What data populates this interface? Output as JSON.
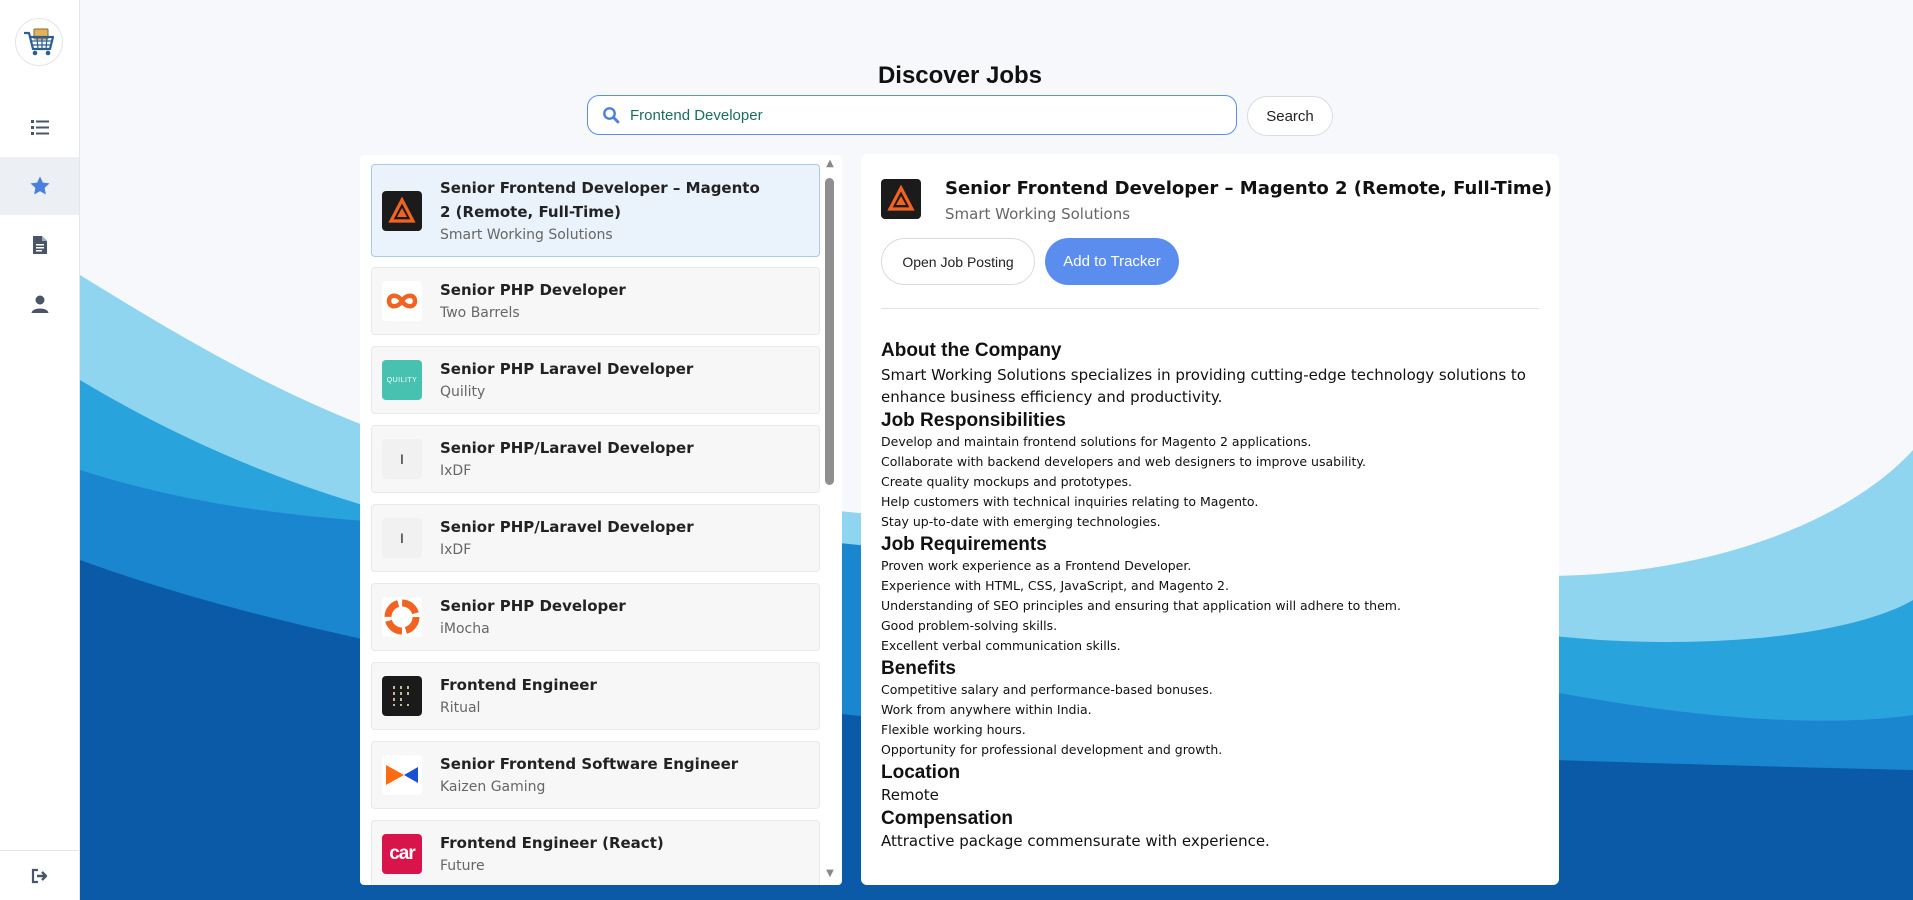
{
  "colors": {
    "accent": "#5b8def",
    "sidebar_active_bg": "#eceff4",
    "wave_light": "#8fd5f0",
    "wave_mid": "#29a3dc",
    "wave_dark": "#0e6fbd",
    "wave_deep": "#0b5aa8"
  },
  "sidebar": {
    "logo_icon": "shopping-cart-icon",
    "items": [
      {
        "name": "list-icon",
        "active": false
      },
      {
        "name": "star-icon",
        "active": true
      },
      {
        "name": "document-icon",
        "active": false
      },
      {
        "name": "user-icon",
        "active": false
      }
    ],
    "logout_icon": "logout-icon"
  },
  "header": {
    "title": "Discover Jobs"
  },
  "search": {
    "value": "Frontend Developer",
    "button_label": "Search"
  },
  "jobs": [
    {
      "title": "Senior Frontend Developer – Magento 2 (Remote, Full-Time)",
      "company": "Smart Working Solutions",
      "logo": "magento-a-logo"
    },
    {
      "title": "Senior PHP Developer",
      "company": "Two Barrels",
      "logo": "infinity-logo"
    },
    {
      "title": "Senior PHP Laravel Developer",
      "company": "Quility",
      "logo": "quility-logo",
      "logo_text": "QUILITY"
    },
    {
      "title": "Senior PHP/Laravel Developer",
      "company": "IxDF",
      "logo": "ixdf-logo",
      "logo_text": "I"
    },
    {
      "title": "Senior PHP/Laravel Developer",
      "company": "IxDF",
      "logo": "ixdf-logo",
      "logo_text": "I"
    },
    {
      "title": "Senior PHP Developer",
      "company": "iMocha",
      "logo": "imocha-logo"
    },
    {
      "title": "Frontend Engineer",
      "company": "Ritual",
      "logo": "ritual-logo"
    },
    {
      "title": "Senior Frontend Software Engineer",
      "company": "Kaizen Gaming",
      "logo": "kaizen-logo"
    },
    {
      "title": "Frontend Engineer (React)",
      "company": "Future",
      "logo": "future-logo",
      "logo_text": "car"
    }
  ],
  "detail": {
    "title": "Senior Frontend Developer – Magento 2 (Remote, Full-Time)",
    "company": "Smart Working Solutions",
    "open_button": "Open Job Posting",
    "track_button": "Add to Tracker",
    "about_heading": "About the Company",
    "about_text": "Smart Working Solutions specializes in providing cutting-edge technology solutions to enhance business efficiency and productivity.",
    "resp_heading": "Job Responsibilities",
    "responsibilities": [
      "Develop and maintain frontend solutions for Magento 2 applications.",
      "Collaborate with backend developers and web designers to improve usability.",
      "Create quality mockups and prototypes.",
      "Help customers with technical inquiries relating to Magento.",
      "Stay up-to-date with emerging technologies."
    ],
    "req_heading": "Job Requirements",
    "requirements": [
      "Proven work experience as a Frontend Developer.",
      "Experience with HTML, CSS, JavaScript, and Magento 2.",
      "Understanding of SEO principles and ensuring that application will adhere to them.",
      "Good problem-solving skills.",
      "Excellent verbal communication skills."
    ],
    "benefits_heading": "Benefits",
    "benefits": [
      "Competitive salary and performance-based bonuses.",
      "Work from anywhere within India.",
      "Flexible working hours.",
      "Opportunity for professional development and growth."
    ],
    "location_heading": "Location",
    "location": "Remote",
    "comp_heading": "Compensation",
    "compensation": "Attractive package commensurate with experience."
  }
}
